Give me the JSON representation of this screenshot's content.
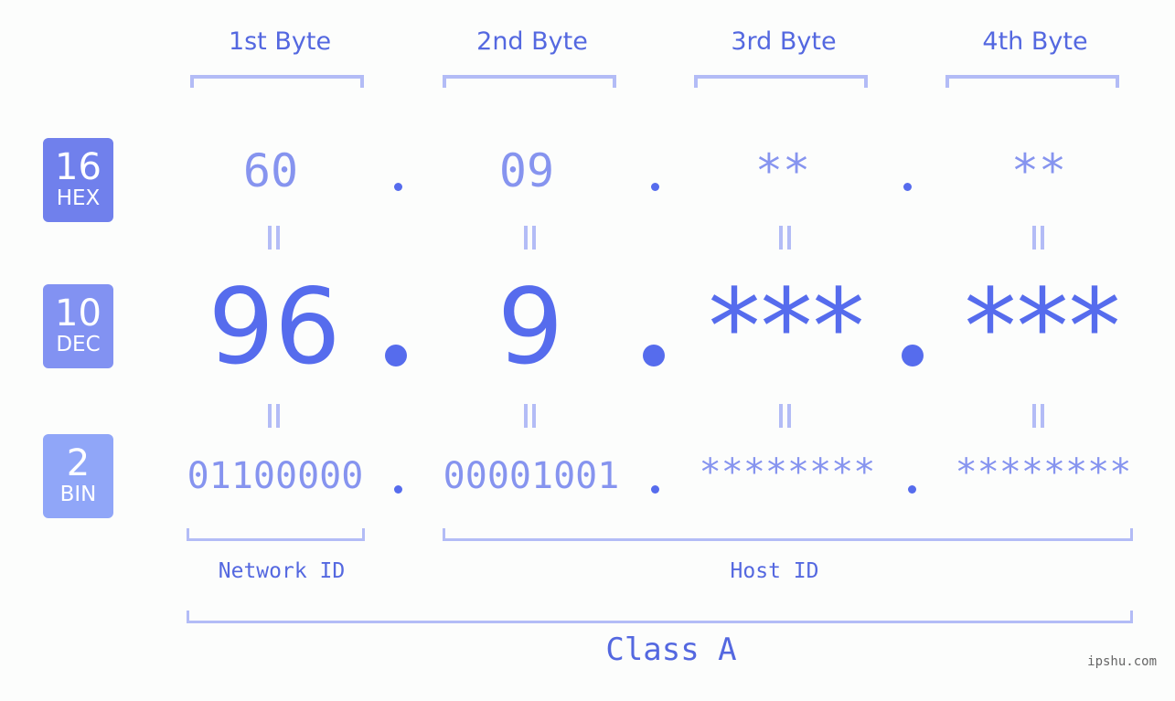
{
  "columns": [
    "1st Byte",
    "2nd Byte",
    "3rd Byte",
    "4th Byte"
  ],
  "badges": [
    {
      "num": "16",
      "label": "HEX",
      "color": "#7080ec"
    },
    {
      "num": "10",
      "label": "DEC",
      "color": "#8292f2"
    },
    {
      "num": "2",
      "label": "BIN",
      "color": "#90a6f8"
    }
  ],
  "hex": [
    "60",
    "09",
    "**",
    "**"
  ],
  "dec": [
    "96",
    "9",
    "***",
    "***"
  ],
  "bin": [
    "01100000",
    "00001001",
    "********",
    "********"
  ],
  "separator": ".",
  "equals": "=",
  "network_id_label": "Network ID",
  "host_id_label": "Host ID",
  "class_label": "Class A",
  "watermark": "ipshu.com",
  "colors": {
    "primary_text": "#5468e0",
    "muted_value": "#8694ef",
    "dec_value": "#566ced",
    "bracket": "#b3bcf6"
  }
}
